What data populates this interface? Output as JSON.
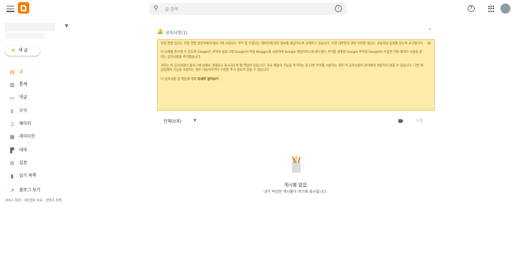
{
  "header": {
    "search_placeholder": "글 검색",
    "help_icon": "?"
  },
  "sidebar": {
    "new_post_label": "새 글",
    "items": [
      {
        "label": "글",
        "icon": "posts-icon",
        "glyph": "▤",
        "active": true
      },
      {
        "label": "통계",
        "icon": "stats-icon",
        "glyph": "▥"
      },
      {
        "label": "댓글",
        "icon": "comments-icon",
        "glyph": "▭"
      },
      {
        "label": "수익",
        "icon": "earnings-icon",
        "glyph": "$"
      },
      {
        "label": "페이지",
        "icon": "pages-icon",
        "glyph": "▯"
      },
      {
        "label": "레이아웃",
        "icon": "layout-icon",
        "glyph": "▦"
      },
      {
        "label": "테마",
        "icon": "theme-icon",
        "glyph": "▛"
      },
      {
        "label": "설정",
        "icon": "settings-icon",
        "glyph": "⚙"
      },
      {
        "label": "읽기 목록",
        "icon": "reading-list-icon",
        "glyph": "▮"
      }
    ],
    "view_blog_label": "블로그 보기",
    "footer_links": [
      "서비스 약관",
      "개인정보 보호",
      "콘텐츠 정책"
    ]
  },
  "notice": {
    "title": "공지사항(1)",
    "paragraphs": [
      "유럽 연합 법규는 유럽 연합 방문자에게 블로그에 사용되는 쿠키 및 수집되는 데이터에 대한 정보를 제공하도록 규제하고 있습니다. 또한 대부분의 경우 이러한 법규는 사용자의 동의를 얻도록 요구합니다.",
      "이 규제를 준수할 수 있도록 Google은 귀하의 블로그에 Google이 특정 Blogger를 사용하며 Google 애널리틱스와 애드센스 쿠키를 비롯한 Google 쿠키와 Google이 수집한 기타 데이터 사용을 알리는 공지사항을 추가했습니다.",
      "귀하는 이 공지사항이 블로그에 실제로 게재되고 표시되도록 할 책임이 있습니다. 자사 제품의 기능을 추가하는 등 다른 쿠키를 사용하는 경우 이 공지사항이 귀하에게 적합하지 않을 수 있습니다. 다른 제공업체의 기능을 포함하는 경우 사용자로부터 수집한 추가 정보가 있을 수 있습니다."
    ],
    "footer_prefix": "이 공지사항 및 책임에 대해 ",
    "learn_more": "자세히 알아보기"
  },
  "filter": {
    "label": "전체(0개)",
    "delete_label": "삭제"
  },
  "empty": {
    "title": "게시물 없음",
    "subtitle": "내가 작성한 게시물이 여기에 표시됩니다."
  }
}
